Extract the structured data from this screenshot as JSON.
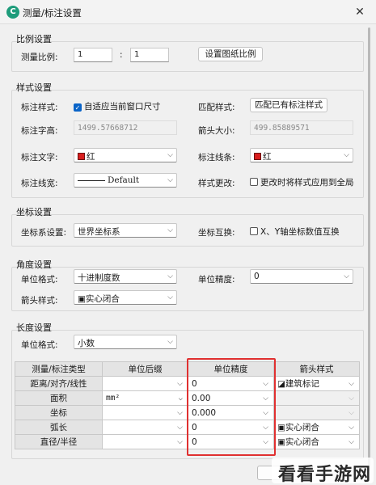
{
  "window": {
    "title": "测量/标注设置",
    "app_icon": "C",
    "close_glyph": "✕"
  },
  "scale": {
    "section": "比例设置",
    "label": "测量比例:",
    "left": "1",
    "sep": ":",
    "right": "1",
    "button": "设置图纸比例"
  },
  "style": {
    "section": "样式设置",
    "mark_style_label": "标注样式:",
    "adapt_checkbox": "自适应当前窗口尺寸",
    "adapt_checked": true,
    "match_label": "匹配样式:",
    "match_button": "匹配已有标注样式",
    "text_height_label": "标注字高:",
    "text_height_value": "1499.57668712",
    "arrow_size_label": "箭头大小:",
    "arrow_size_value": "499.85889571",
    "text_color_label": "标注文字:",
    "text_color_value": "红",
    "line_color_label": "标注线条:",
    "line_color_value": "红",
    "line_width_label": "标注线宽:",
    "line_width_value": "Default",
    "change_label": "样式更改:",
    "change_checkbox": "更改时将样式应用到全局",
    "change_checked": false,
    "color_red": "#d81e1e"
  },
  "coord": {
    "section": "坐标设置",
    "system_label": "坐标系设置:",
    "system_value": "世界坐标系",
    "swap_label": "坐标互换:",
    "swap_checkbox": "X、Y轴坐标数值互换",
    "swap_checked": false
  },
  "angle": {
    "section": "角度设置",
    "unit_label": "单位格式:",
    "unit_value": "十进制度数",
    "precision_label": "单位精度:",
    "precision_value": "0",
    "arrow_label": "箭头样式:",
    "arrow_value": "实心闭合"
  },
  "length": {
    "section": "长度设置",
    "unit_label": "单位格式:",
    "unit_value": "小数",
    "columns": [
      "测量/标注类型",
      "单位后缀",
      "单位精度",
      "箭头样式"
    ],
    "rows": [
      {
        "type": "距离/对齐/线性",
        "suffix": "",
        "precision": "0",
        "arrow": "建筑标记"
      },
      {
        "type": "面积",
        "suffix": "mm²",
        "precision": "0.00",
        "arrow": ""
      },
      {
        "type": "坐标",
        "suffix": "",
        "precision": "0.000",
        "arrow": ""
      },
      {
        "type": "弧长",
        "suffix": "",
        "precision": "0",
        "arrow": "实心闭合"
      },
      {
        "type": "直径/半径",
        "suffix": "",
        "precision": "0",
        "arrow": "实心闭合"
      }
    ],
    "highlight_color": "#e03030"
  },
  "watermark": {
    "text": "看看手游网"
  }
}
